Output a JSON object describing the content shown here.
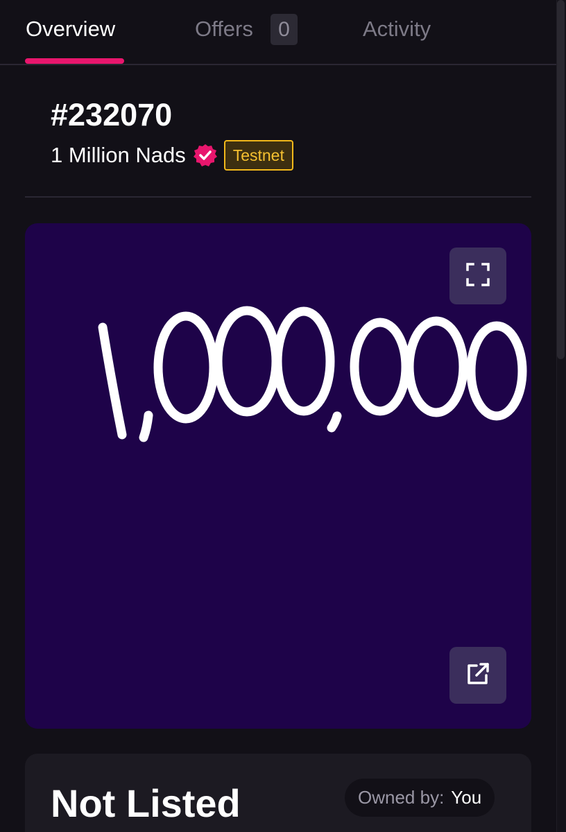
{
  "tabs": {
    "overview": "Overview",
    "offers": "Offers",
    "offers_count": "0",
    "activity": "Activity"
  },
  "token": {
    "id": "#232070",
    "collection": "1 Million Nads",
    "network_badge": "Testnet"
  },
  "media": {
    "artwork_text": "1,000,000",
    "background_color": "#1e0349"
  },
  "listing": {
    "status": "Not Listed",
    "owner_label": "Owned by:",
    "owner_value": "You"
  },
  "colors": {
    "accent": "#e8166d",
    "badge": "#f2b81a",
    "background": "#121017"
  },
  "icons": {
    "verified": "verified-badge-icon",
    "expand": "fullscreen-icon",
    "external": "external-link-icon"
  }
}
